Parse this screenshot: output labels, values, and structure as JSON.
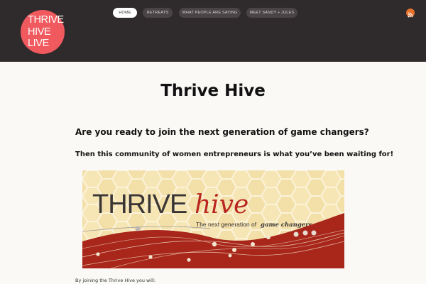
{
  "site": {
    "logo_lines": [
      "THRIVE",
      "HIVE",
      "LIVE"
    ]
  },
  "nav": {
    "items": [
      {
        "label": "HOME",
        "active": true
      },
      {
        "label": "RETREATS",
        "active": false
      },
      {
        "label": "WHAT PEOPLE ARE SAYING",
        "active": false
      },
      {
        "label": "MEET SANDY + JULES",
        "active": false
      }
    ],
    "feed_icon": "rss-icon"
  },
  "main": {
    "title": "Thrive Hive",
    "heading": "Are you ready to join the next generation of game changers?",
    "subheading": "Then this community of women entrepreneurs is what you’ve been waiting for!",
    "banner": {
      "brand_a": "THRIVE",
      "brand_b": "hive",
      "tagline_a": "The next generation of",
      "tagline_b": "game changers"
    },
    "intro": "By joining the Thrive Hive you will:"
  },
  "colors": {
    "header_bg": "#2f2a2b",
    "logo_bg": "#f05a5f",
    "accent_red": "#a8261a",
    "brand_script": "#b8271f",
    "rss": "#e8722c"
  }
}
